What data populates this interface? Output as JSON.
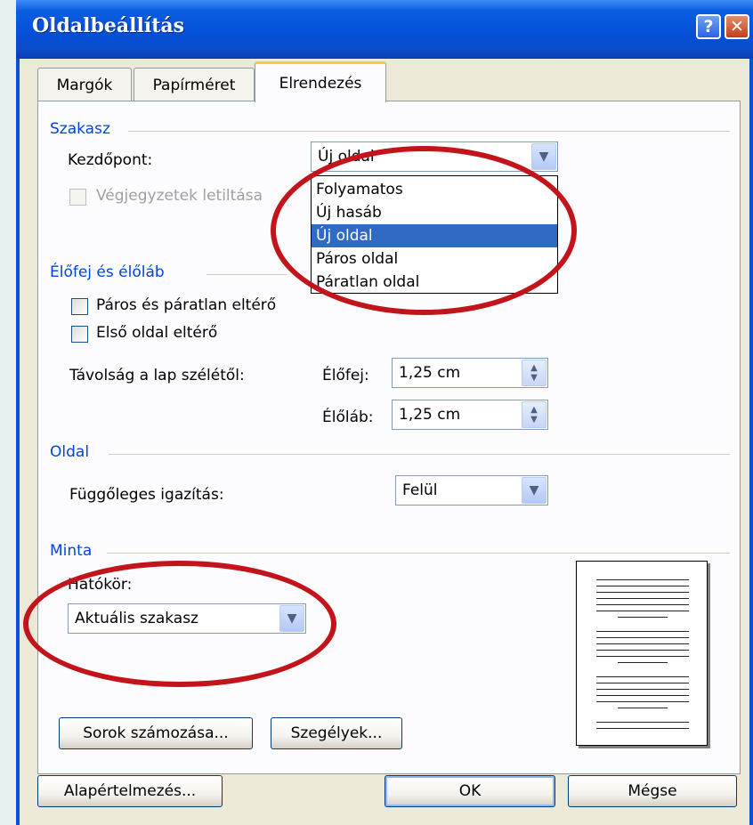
{
  "window": {
    "title": "Oldalbeállítás",
    "help_label": "?",
    "close_label": "✕"
  },
  "tabs": [
    {
      "label": "Margók"
    },
    {
      "label": "Papírméret"
    },
    {
      "label": "Elrendezés",
      "active": true
    }
  ],
  "section": {
    "title": "Szakasz",
    "start_label": "Kezdőpont:",
    "start_value": "Új oldal",
    "suppress_endnotes_label": "Végjegyzetek letiltása",
    "options": [
      "Folyamatos",
      "Új hasáb",
      "Új oldal",
      "Páros oldal",
      "Páratlan oldal"
    ],
    "selected_option": "Új oldal"
  },
  "headers_footers": {
    "title": "Élőfej és élőláb",
    "odd_even_label": "Páros és páratlan eltérő",
    "first_page_label": "Első oldal eltérő",
    "distance_label": "Távolság a lap szélétől:",
    "header_label": "Élőfej:",
    "header_value": "1,25 cm",
    "footer_label": "Élőláb:",
    "footer_value": "1,25 cm"
  },
  "page": {
    "title": "Oldal",
    "vertical_align_label": "Függőleges igazítás:",
    "vertical_align_value": "Felül"
  },
  "preview": {
    "title": "Minta",
    "apply_to_label": "Hatókör:",
    "apply_to_value": "Aktuális szakasz"
  },
  "buttons": {
    "line_numbers": "Sorok számozása...",
    "borders": "Szegélyek...",
    "default": "Alapértelmezés...",
    "ok": "OK",
    "cancel": "Mégse"
  },
  "icons": {
    "dropdown_arrow": "chevron-down-icon",
    "spin": "spin-arrows-icon"
  },
  "colors": {
    "accent": "#0046d5",
    "selection": "#316ac5",
    "annotation": "#c4141b"
  }
}
